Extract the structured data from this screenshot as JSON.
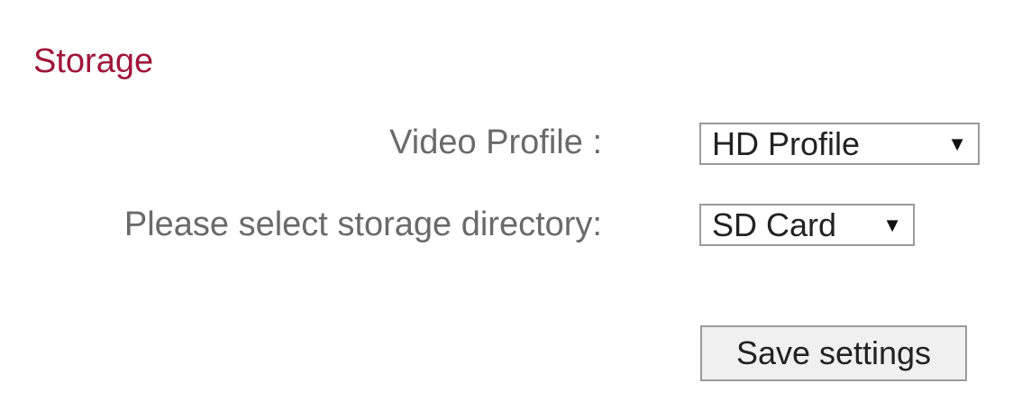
{
  "section": {
    "title": "Storage"
  },
  "fields": {
    "video_profile": {
      "label": "Video Profile :",
      "selected": "HD Profile"
    },
    "storage_directory": {
      "label": "Please select storage directory:",
      "selected": "SD Card"
    }
  },
  "actions": {
    "save_label": "Save settings"
  },
  "icons": {
    "dropdown_arrow": "▼"
  },
  "colors": {
    "section_title": "#a0163a",
    "label_text": "#6a6a6a"
  }
}
